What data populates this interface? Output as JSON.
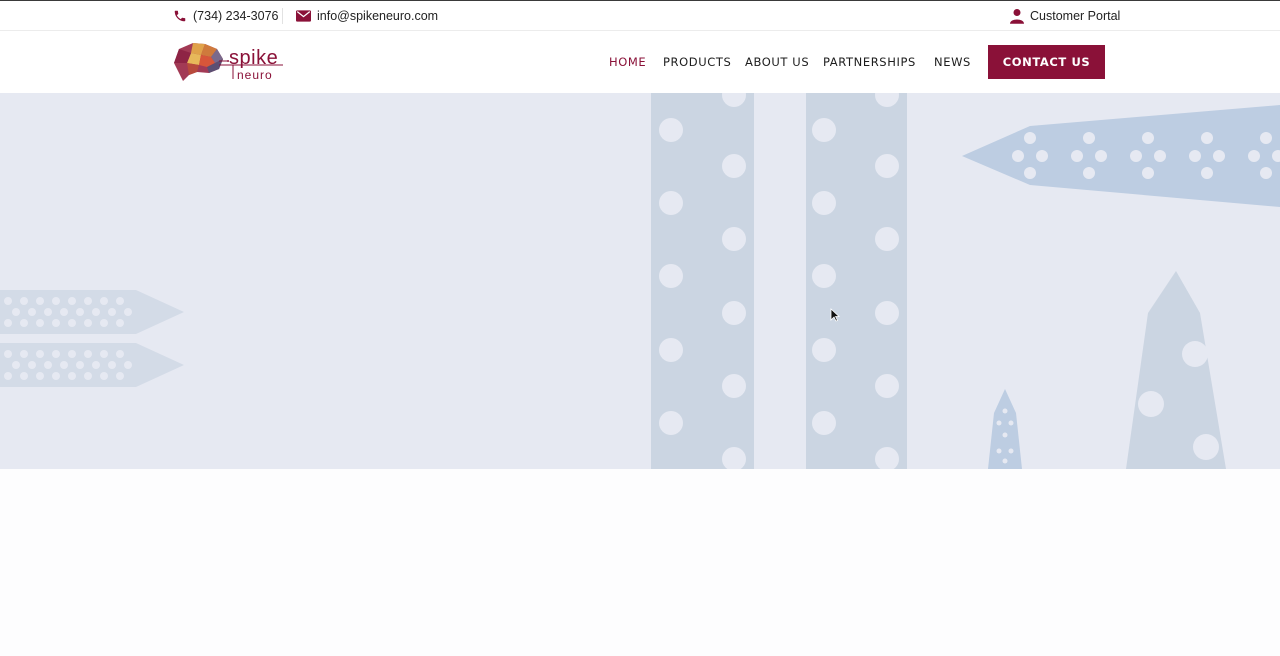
{
  "topbar": {
    "phone": "(734) 234-3076",
    "email": "info@spikeneuro.com",
    "portal": "Customer Portal",
    "icons": [
      "phone-icon",
      "mail-icon",
      "user-icon"
    ]
  },
  "brand": {
    "name": "spike",
    "sub": "neuro",
    "color": "#8a1138"
  },
  "nav": {
    "home": "HOME",
    "products": "PRODUCTS",
    "about": "ABOUT US",
    "partnerships": "PARTNERSHIPS",
    "news": "NEWS",
    "contact": "CONTACT US",
    "active": "HOME"
  },
  "hero": {
    "background": "#e6e9f2",
    "probe_color": "#c5d3e6"
  }
}
